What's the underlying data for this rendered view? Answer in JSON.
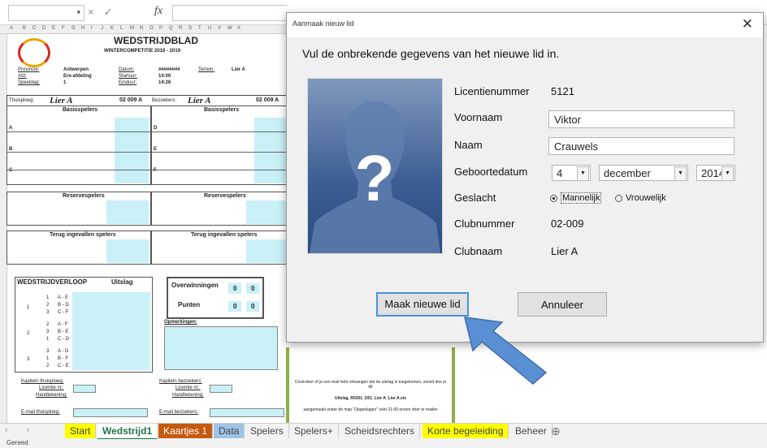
{
  "formula_bar": {
    "fx_label": "fx",
    "cancel_glyph": "×",
    "confirm_glyph": "✓"
  },
  "sheet": {
    "title": "WEDSTRIJDBLAD",
    "subtitle": "WINTERCOMPETITIE 2018 - 2019",
    "provincie_label": "Provincie:",
    "provincie_value": "Antwerpen",
    "afd_label": "Afd:",
    "afd_value": "Ere-afdeling",
    "speeldag_label": "Speeldag:",
    "speeldag_value": "1",
    "datum_label": "Datum:",
    "datum_value": "########",
    "starturur_label": "Startuur:",
    "starturur_value": "14:00",
    "einduur_label": "Einduur:",
    "einduur_value": "14:26",
    "terrein_label": "Terrein:",
    "terrein_value": "Lier A",
    "thuisploeg_label": "Thuisploeg:",
    "thuisploeg_value": "Lier A",
    "thuis_code": "02 009 A",
    "bezoekers_label": "Bezoekers:",
    "bezoekers_value": "Lier A",
    "bez_code": "02 009 A",
    "basisspelers": "Basisspelers",
    "reservespelers": "Reservespelers",
    "terug_ingevallen": "Terug ingevallen spelers",
    "wedstrijdverloop": "WEDSTRIJDVERLOOP",
    "uitslag": "Uitslag",
    "overwinningen": "Overwinningen",
    "punten": "Punten",
    "opmerkingen": "Opmerkingen:",
    "kapitein_thuis": "Kapitein thuisploeg:",
    "kapitein_bez": "Kapitein bezoekers:",
    "licentie": "Licentie nr.:",
    "handtekening": "Handtekening:",
    "email_thuis": "E-mail thuisploeg:",
    "email_bez": "E-mail bezoekers:",
    "score_values": [
      "0",
      "0",
      "0",
      "0"
    ],
    "rows": [
      {
        "ronde": "1",
        "zones": [
          "1",
          "2",
          "3"
        ],
        "teams": [
          "A - E",
          "B - D",
          "C - F"
        ]
      },
      {
        "ronde": "2",
        "zones": [
          "2",
          "3",
          "1"
        ],
        "teams": [
          "A - F",
          "B - E",
          "C - D"
        ]
      },
      {
        "ronde": "3",
        "zones": [
          "3",
          "1",
          "2"
        ],
        "teams": [
          "A - D",
          "B - F",
          "C - E"
        ]
      }
    ],
    "green_text": [
      "Controleer of je een mail hebt ontvangen dat de uitslag is toegekomen, zoniet doe je dit",
      "Uitslag_R0201_D01_Lier A_Lier A.xls",
      "aangemaakt onder de map \"Opgeslagen\" vóór 21:00 ervoor door te mailen"
    ]
  },
  "tabs": [
    {
      "label": "Start",
      "color": "#ffff00"
    },
    {
      "label": "Wedstrijd1",
      "color": "#ffffff"
    },
    {
      "label": "Kaartjes 1",
      "color": "#c55a11"
    },
    {
      "label": "Data",
      "color": "#9dc3e6"
    },
    {
      "label": "Spelers",
      "color": "#f2f2f2"
    },
    {
      "label": "Spelers+",
      "color": "#f2f2f2"
    },
    {
      "label": "Scheidsrechters",
      "color": "#f2f2f2"
    },
    {
      "label": "Korte begeleiding",
      "color": "#ffff00"
    },
    {
      "label": "Beheer",
      "color": "#f2f2f2"
    }
  ],
  "add_sheet_glyph": "⊕",
  "status": {
    "text": "Gereed"
  },
  "dialog": {
    "title": "Aanmaak nieuw lid",
    "close_glyph": "✕",
    "heading": "Vul de onbrekende gegevens van het nieuwe lid in.",
    "placeholder_glyph": "?",
    "licentie_label": "Licentienummer",
    "licentie_value": "5121",
    "voornaam_label": "Voornaam",
    "voornaam_value": "Viktor",
    "naam_label": "Naam",
    "naam_value": "Crauwels",
    "geboortedatum_label": "Geboortedatum",
    "dag": "4",
    "maand": "december",
    "jaar": "2014",
    "geslacht_label": "Geslacht",
    "mannelijk": "Mannelijk",
    "vrouwelijk": "Vrouwelijk",
    "clubnummer_label": "Clubnummer",
    "clubnummer_value": "02-009",
    "clubnaam_label": "Clubnaam",
    "clubnaam_value": "Lier A",
    "ok_button": "Maak nieuwe lid",
    "cancel_button": "Annuleer"
  },
  "colors": {
    "arrow": "#5b8fd3",
    "photo": "#3b5d93",
    "sheet_highlight": "#c9f0f7",
    "green_border": "#8cb04a"
  }
}
